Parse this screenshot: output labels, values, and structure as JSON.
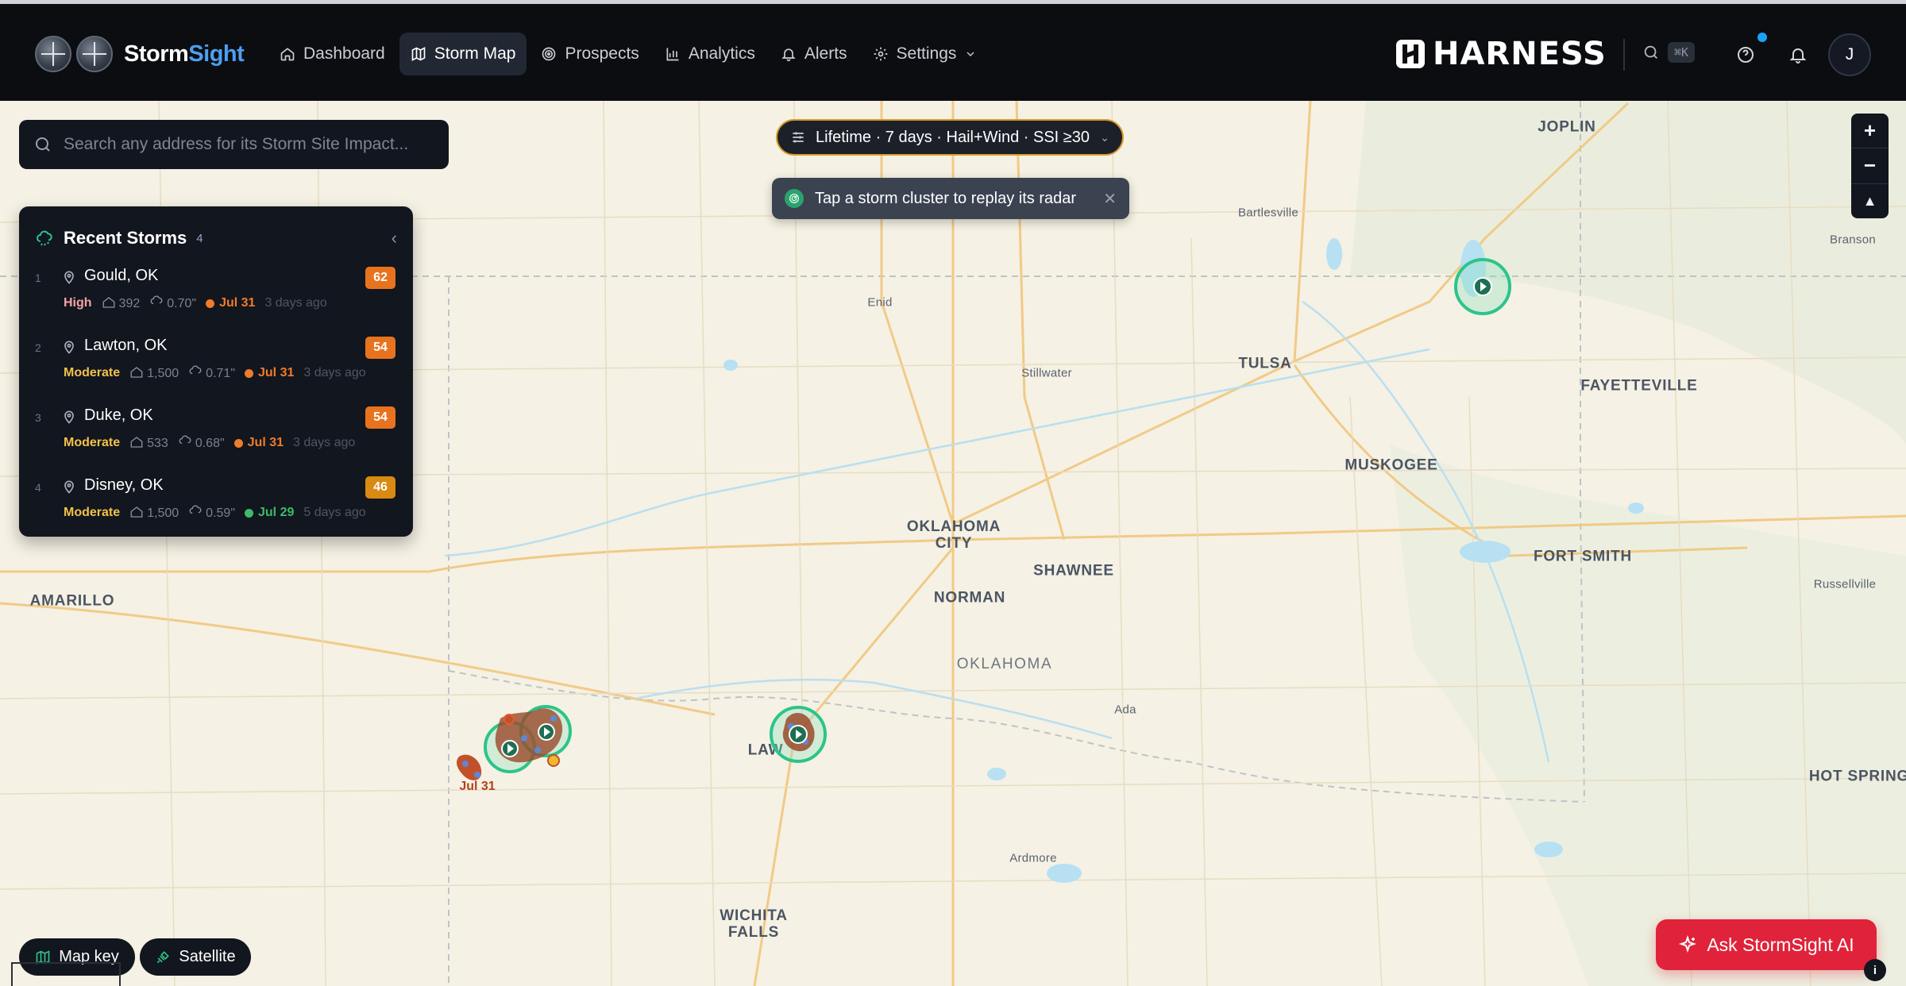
{
  "app": {
    "name_part1": "Storm",
    "name_part2": "Sight",
    "brand": "HARNESS",
    "shortcut": "⌘K",
    "avatar_initial": "J"
  },
  "nav": {
    "items": [
      {
        "label": "Dashboard",
        "icon": "home-icon"
      },
      {
        "label": "Storm Map",
        "icon": "map-icon",
        "active": true
      },
      {
        "label": "Prospects",
        "icon": "target-icon"
      },
      {
        "label": "Analytics",
        "icon": "bar-chart-icon"
      },
      {
        "label": "Alerts",
        "icon": "bell-icon"
      },
      {
        "label": "Settings",
        "icon": "gear-icon"
      }
    ]
  },
  "search": {
    "placeholder": "Search any address for its Storm Site Impact..."
  },
  "filter": {
    "label": "Lifetime · 7 days · Hail+Wind · SSI ≥30"
  },
  "toast": {
    "message": "Tap a storm cluster to replay its radar"
  },
  "zoom": {
    "in": "+",
    "out": "−",
    "reset": "▲"
  },
  "recent_storms": {
    "title": "Recent Storms",
    "count": "4",
    "items": [
      {
        "index": "1",
        "name": "Gould, OK",
        "score": "62",
        "score_color": "#e8731f",
        "severity": "High",
        "severity_color": "#f3a3a6",
        "homes": "392",
        "hail": "0.70\"",
        "date": "Jul 31",
        "date_color": "#ef7c2a",
        "ago": "3 days ago"
      },
      {
        "index": "2",
        "name": "Lawton, OK",
        "score": "54",
        "score_color": "#e8731f",
        "severity": "Moderate",
        "severity_color": "#f2c24a",
        "homes": "1,500",
        "hail": "0.71\"",
        "date": "Jul 31",
        "date_color": "#ef7c2a",
        "ago": "3 days ago"
      },
      {
        "index": "3",
        "name": "Duke, OK",
        "score": "54",
        "score_color": "#e8731f",
        "severity": "Moderate",
        "severity_color": "#f2c24a",
        "homes": "533",
        "hail": "0.68\"",
        "date": "Jul 31",
        "date_color": "#ef7c2a",
        "ago": "3 days ago"
      },
      {
        "index": "4",
        "name": "Disney, OK",
        "score": "46",
        "score_color": "#d98a12",
        "severity": "Moderate",
        "severity_color": "#f2c24a",
        "homes": "1,500",
        "hail": "0.59\"",
        "date": "Jul 29",
        "date_color": "#3dbb6b",
        "ago": "5 days ago"
      }
    ]
  },
  "map": {
    "places": [
      {
        "name": "JOPLIN",
        "kind": "big"
      },
      {
        "name": "Bartlesville",
        "kind": "small"
      },
      {
        "name": "Branson",
        "kind": "small"
      },
      {
        "name": "Enid",
        "kind": "small"
      },
      {
        "name": "Stillwater",
        "kind": "small"
      },
      {
        "name": "TULSA",
        "kind": "big"
      },
      {
        "name": "FAYETTEVILLE",
        "kind": "big"
      },
      {
        "name": "MUSKOGEE",
        "kind": "big"
      },
      {
        "name": "OKLAHOMA\nCITY",
        "kind": "big"
      },
      {
        "name": "SHAWNEE",
        "kind": "big"
      },
      {
        "name": "NORMAN",
        "kind": "big"
      },
      {
        "name": "FORT SMITH",
        "kind": "big"
      },
      {
        "name": "Russellville",
        "kind": "small"
      },
      {
        "name": "AMARILLO",
        "kind": "big"
      },
      {
        "name": "OKLAHOMA",
        "kind": "state"
      },
      {
        "name": "Ada",
        "kind": "small"
      },
      {
        "name": "LAW",
        "kind": "big"
      },
      {
        "name": "HOT SPRING",
        "kind": "big"
      },
      {
        "name": "Ardmore",
        "kind": "small"
      },
      {
        "name": "WICHITA\nFALLS",
        "kind": "big"
      }
    ],
    "storm_label": "Jul 31"
  },
  "controls": {
    "map_key": "Map key",
    "satellite": "Satellite",
    "ask_ai": "Ask StormSight AI",
    "info": "i"
  }
}
